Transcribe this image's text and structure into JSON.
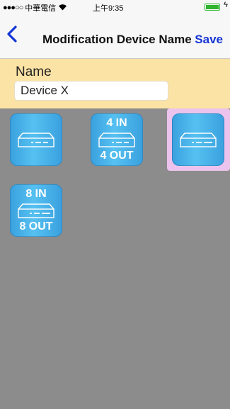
{
  "status_bar": {
    "signal": "●●●○○",
    "carrier": "中華電信",
    "time": "上午9:35"
  },
  "nav": {
    "title": "Modification Device Name",
    "save_label": "Save"
  },
  "name_section": {
    "label": "Name",
    "value": "Device X"
  },
  "devices": [
    {
      "top_label": "",
      "bottom_label": "",
      "selected": false
    },
    {
      "top_label": "4 IN",
      "bottom_label": "4 OUT",
      "selected": false
    },
    {
      "top_label": "",
      "bottom_label": "",
      "selected": true
    },
    {
      "top_label": "8 IN",
      "bottom_label": "8 OUT",
      "selected": false
    }
  ],
  "colors": {
    "accent": "#1535d6",
    "name_panel": "#fbe3a5",
    "grid_background": "#8c8c8c",
    "selection": "#ecc3ec"
  }
}
